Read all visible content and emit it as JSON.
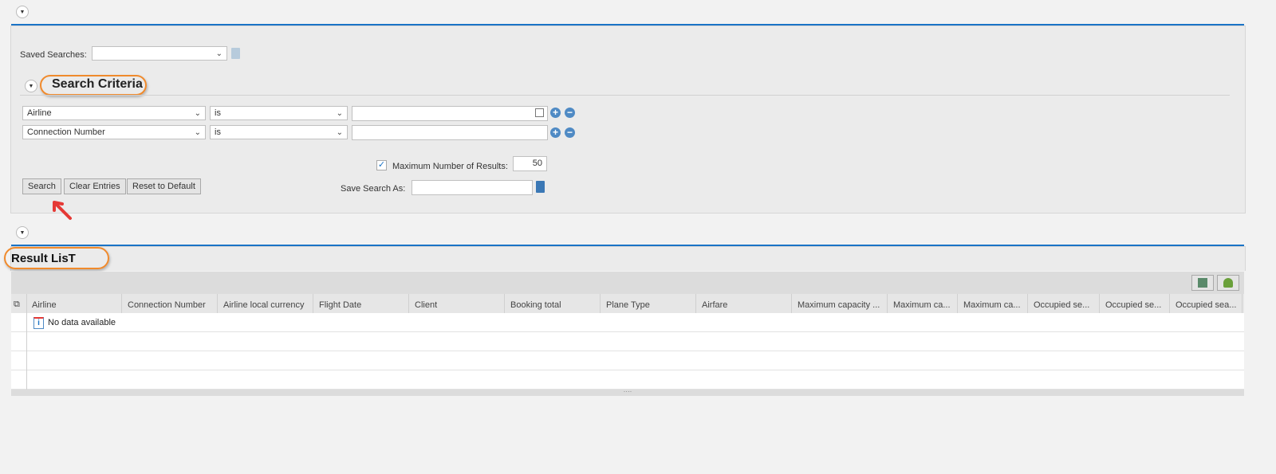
{
  "search_panel": {
    "saved_searches_label": "Saved Searches:",
    "saved_searches_value": "",
    "criteria_title": "Search Criteria",
    "criteria": [
      {
        "field": "Airline",
        "operator": "is",
        "value": ""
      },
      {
        "field": "Connection Number",
        "operator": "is",
        "value": ""
      }
    ],
    "max_results_label": "Maximum Number of Results:",
    "max_results_checked": true,
    "max_results_value": "50",
    "save_search_label": "Save Search As:",
    "save_search_value": "",
    "buttons": {
      "search": "Search",
      "clear": "Clear Entries",
      "reset": "Reset to Default"
    }
  },
  "result_list": {
    "title": "Result LisT",
    "columns": [
      "Airline",
      "Connection Number",
      "Airline local currency",
      "Flight Date",
      "Client",
      "Booking total",
      "Plane Type",
      "Airfare",
      "Maximum capacity ...",
      "Maximum ca...",
      "Maximum ca...",
      "Occupied se...",
      "Occupied se...",
      "Occupied sea..."
    ],
    "empty_message": "No data available"
  },
  "colors": {
    "accent": "#1a73c6",
    "annotation": "#f08a2c",
    "arrow": "#e53935",
    "icon_blue": "#4f8ac4"
  }
}
